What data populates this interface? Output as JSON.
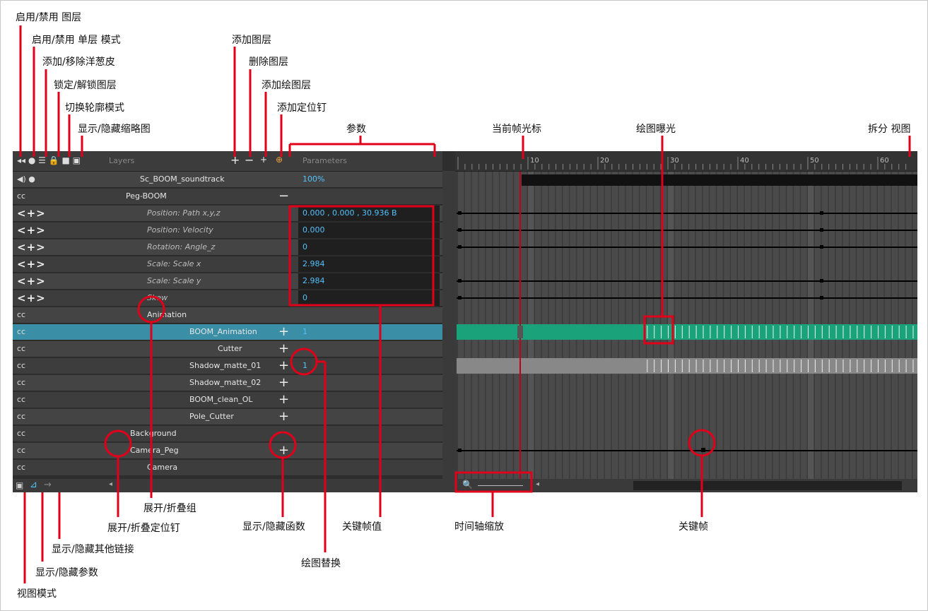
{
  "labels": {
    "enable_disable_layer": "启用/禁用 图层",
    "enable_disable_solo": "启用/禁用 单层 模式",
    "add_remove_onion": "添加/移除洋葱皮",
    "lock_unlock_layer": "锁定/解锁图层",
    "toggle_outline": "切换轮廓模式",
    "show_hide_thumb": "显示/隐藏缩略图",
    "add_layer": "添加图层",
    "delete_layer": "删除图层",
    "add_drawing_layer": "添加绘图层",
    "add_peg": "添加定位钉",
    "parameters": "参数",
    "current_frame_cursor": "当前帧光标",
    "drawing_exposure": "绘图曝光",
    "split_view": "拆分 视图",
    "expand_collapse_group": "展开/折叠组",
    "expand_collapse_peg": "展开/折叠定位钉",
    "show_hide_function": "显示/隐藏函数",
    "keyframe_value": "关键帧值",
    "drawing_substitution": "绘图替换",
    "timeline_zoom": "时间轴缩放",
    "keyframe": "关键帧",
    "show_hide_links": "显示/隐藏其他链接",
    "show_hide_params": "显示/隐藏参数",
    "view_mode": "视图模式"
  },
  "panel": {
    "layers_header": "Layers",
    "parameters_header": "Parameters",
    "ruler_ticks": [
      "10",
      "20",
      "30",
      "40",
      "50",
      "60"
    ],
    "rows": [
      {
        "name": "Sc_BOOM_soundtrack",
        "param": "100%"
      },
      {
        "name": "Peg-BOOM",
        "param": ""
      },
      {
        "name": "Position: Path x,y,z",
        "param": "0.000 , 0.000 , 30.936 B"
      },
      {
        "name": "Position: Velocity",
        "param": "0.000"
      },
      {
        "name": "Rotation: Angle_z",
        "param": "0"
      },
      {
        "name": "Scale: Scale x",
        "param": "2.984"
      },
      {
        "name": "Scale: Scale y",
        "param": "2.984"
      },
      {
        "name": "Skew",
        "param": "0"
      },
      {
        "name": "Animation",
        "param": ""
      },
      {
        "name": "BOOM_Animation",
        "param": "1"
      },
      {
        "name": "Cutter",
        "param": ""
      },
      {
        "name": "Shadow_matte_01",
        "param": "1"
      },
      {
        "name": "Shadow_matte_02",
        "param": ""
      },
      {
        "name": "BOOM_clean_OL",
        "param": ""
      },
      {
        "name": "Pole_Cutter",
        "param": ""
      },
      {
        "name": "Background",
        "param": ""
      },
      {
        "name": "Camera_Peg",
        "param": ""
      },
      {
        "name": "Camera",
        "param": ""
      }
    ]
  },
  "colors": {
    "accent_green": "#1aa37a",
    "annotation_red": "#e0001a",
    "param_blue": "#52c3ff"
  }
}
